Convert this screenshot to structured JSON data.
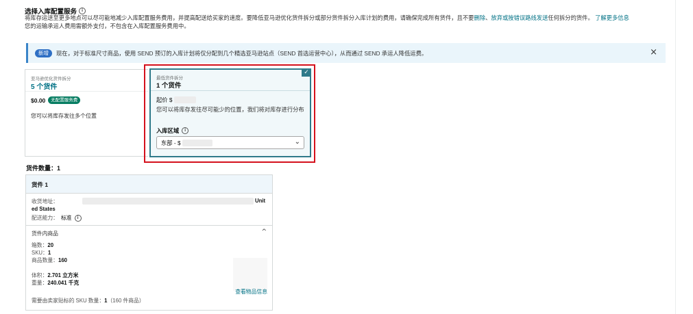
{
  "section": {
    "title": "选择入库配置服务",
    "desc_line1_a": "将库存运送至更多地点可以尽可能地减少入库配置服务费用，并提高配送给买家的速度。要降低亚马逊优化货件拆分或部分货件拆分入库计划的费用，请确保完成所有货件，且不要",
    "desc_link_delete": "删除",
    "desc_sep": "、",
    "desc_link_abandon": "放弃或按错误路线发送",
    "desc_line1_b": "任何拆分的货件。",
    "desc_link_more": "了解更多信息",
    "desc_line2": "您的运输承运人费用需额外支付，不包含在入库配置服务费用中。"
  },
  "banner": {
    "badge": "新增",
    "text": "现在，对于标准尺寸商品，使用 SEND 预订的入库计划将仅分配到几个精选亚马逊站点（SEND 首选运营中心），从而通过 SEND 承运人降低运费。",
    "close": "×"
  },
  "option_a": {
    "label": "亚马逊优化货件拆分",
    "count": "5 个货件",
    "price": "$0.00",
    "fee_badge": "无配置服务费",
    "note": "您可以将库存发往多个位置"
  },
  "option_b": {
    "label": "最低货件拆分",
    "count": "1 个货件",
    "price_prefix": "起价 $",
    "note": "您可以将库存发往尽可能少的位置，我们将对库存进行分布",
    "region_label": "入库区域",
    "region_value": "东部 - $",
    "checked": true
  },
  "shipments": {
    "count_label": "货件数量：1",
    "shipment": {
      "title": "货件 1",
      "addr_label": "收货地址：",
      "addr_tail": "Unit",
      "addr_line2": "ed States",
      "capability_label": "配送能力：",
      "capability_value": "标准",
      "items_title": "货件内商品",
      "box_label": "箱数：",
      "box_value": "20",
      "sku_label": "SKU：",
      "sku_value": "1",
      "qty_label": "商品数量：",
      "qty_value": "160",
      "volume_label": "体积：",
      "volume_value": "2.701 立方米",
      "weight_label": "重量：",
      "weight_value": "240.041 千克",
      "view_link": "查看物品信息",
      "sku_note_label": "需要由卖家贴标的 SKU 数量：",
      "sku_note_value": "1",
      "sku_note_tail": "（160 件商品）"
    }
  }
}
